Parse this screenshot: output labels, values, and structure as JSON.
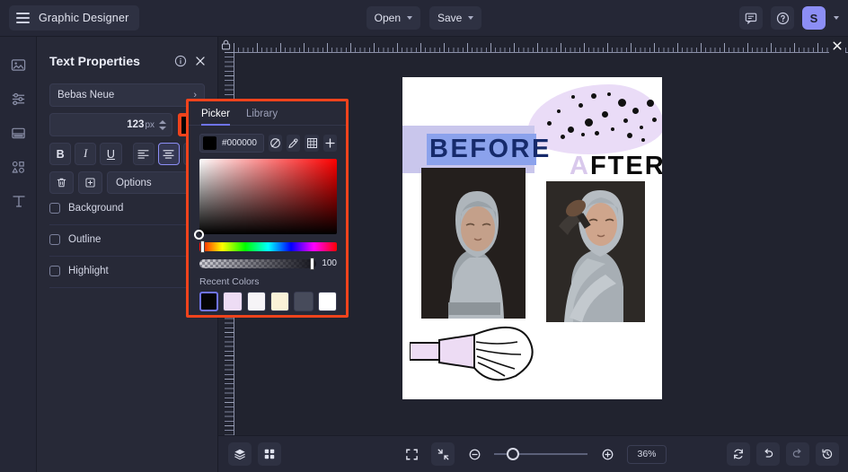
{
  "topbar": {
    "menu_icon": "hamburger-menu-icon",
    "brand": "Graphic Designer",
    "open_label": "Open",
    "save_label": "Save",
    "comment_icon": "comment-icon",
    "help_icon": "help-circle-icon",
    "avatar_initial": "S"
  },
  "rail": {
    "items": [
      {
        "icon": "image-icon",
        "name": "sidebar-item-images"
      },
      {
        "icon": "sliders-icon",
        "name": "sidebar-item-adjust"
      },
      {
        "icon": "layout-icon",
        "name": "sidebar-item-layout"
      },
      {
        "icon": "shapes-icon",
        "name": "sidebar-item-shapes"
      },
      {
        "icon": "text-icon",
        "name": "sidebar-item-text"
      }
    ]
  },
  "panel": {
    "title": "Text Properties",
    "info_icon": "info-circle-icon",
    "close_icon": "close-icon",
    "font_name": "Bebas Neue",
    "font_size": "123",
    "font_size_unit": "px",
    "color_hex": "#000000",
    "bold_label": "B",
    "italic_label": "I",
    "underline_label": "U",
    "align_left": "align-left-icon",
    "align_center": "align-center-icon",
    "align_right": "align-right-icon",
    "delete_icon": "trash-icon",
    "duplicate_icon": "duplicate-icon",
    "options_label": "Options",
    "toggles": [
      {
        "label": "Background",
        "checked": false
      },
      {
        "label": "Outline",
        "checked": false
      },
      {
        "label": "Highlight",
        "checked": false
      }
    ]
  },
  "picker": {
    "tab_picker": "Picker",
    "tab_library": "Library",
    "hex_value": "#000000",
    "swatch_color": "#000000",
    "tool_none_icon": "no-color-icon",
    "tool_eyedropper_icon": "eyedropper-icon",
    "tool_grid_icon": "grid-icon",
    "tool_add_icon": "plus-icon",
    "alpha_value": "100",
    "recent_label": "Recent Colors",
    "recent_colors": [
      "#050505",
      "#eddcf4",
      "#f6f4f7",
      "#faf2d8",
      "#474b5b",
      "#ffffff"
    ],
    "recent_selected_index": 0,
    "highlight_border": "#f0431c"
  },
  "canvas": {
    "lock_icon": "lock-icon",
    "close_icon": "close-icon",
    "artboard": {
      "before_text": "BEFORE",
      "after_text_pale": "A",
      "after_text_rest": "FTER",
      "band_color": "#c9c6ec",
      "highlight_color": "#8ba2ec",
      "before_text_color": "#162a6b",
      "blob_color": "#eadcf7",
      "brush_color": "#eddcf4"
    }
  },
  "bottombar": {
    "layers_icon": "layers-icon",
    "grid_icon": "grid-view-icon",
    "fit_icon": "fit-screen-icon",
    "shrink_icon": "collapse-icon",
    "zoom_out_icon": "zoom-out-icon",
    "zoom_in_icon": "zoom-in-icon",
    "zoom_value": "36%",
    "reset_icon": "refresh-icon",
    "undo_icon": "undo-icon",
    "redo_icon": "redo-icon",
    "history_icon": "history-icon"
  }
}
